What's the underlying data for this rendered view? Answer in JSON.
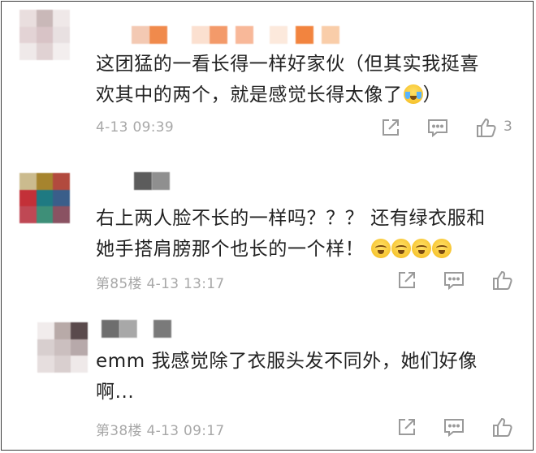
{
  "comments": [
    {
      "text_line1": "这团猛的一看长得一样好家伙（但其实我挺喜",
      "text_line2": "欢其中的两个，就是感觉长得太像了",
      "emoji": "crying-face",
      "meta": "4-13 09:39",
      "like_count": "3"
    },
    {
      "text_line1": "右上两人脸不长的一样吗？？？ 还有绿衣服和",
      "text_line2": "她手搭肩膀那个也长的一个样！",
      "emoji": "laughing-crying-face",
      "emoji_count": 4,
      "meta": "第85楼 4-13 13:17",
      "like_count": ""
    },
    {
      "text_line1": "emm 我感觉除了衣服头发不同外，她们好像",
      "text_line2": "啊...",
      "meta": "第38楼 4-13 09:17",
      "like_count": ""
    }
  ],
  "icons": {
    "share": "share-icon",
    "reply": "comment-icon",
    "like": "thumbs-up-icon"
  },
  "colors": {
    "text": "#222222",
    "meta": "#a8a8a8",
    "icon": "#9a9a9a"
  }
}
